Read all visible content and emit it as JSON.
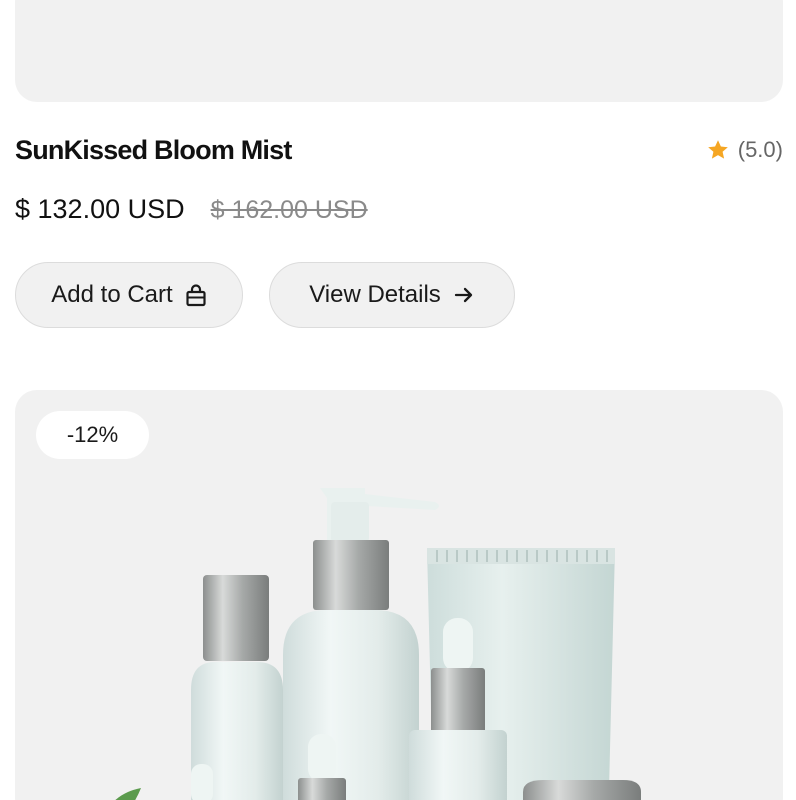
{
  "product": {
    "title": "SunKissed Bloom Mist",
    "rating_text": "(5.0)",
    "price_current": "$ 132.00 USD",
    "price_old": "$ 162.00 USD"
  },
  "actions": {
    "add_to_cart_label": "Add to Cart",
    "view_details_label": "View Details"
  },
  "next_product": {
    "discount_badge": "-12%"
  },
  "colors": {
    "star": "#f5a623",
    "card_bg": "#f1f1f1",
    "button_bg": "#f1f1f1"
  },
  "icons": {
    "rating": "star-icon",
    "cart": "shopping-bag-icon",
    "details": "arrow-right-icon"
  }
}
